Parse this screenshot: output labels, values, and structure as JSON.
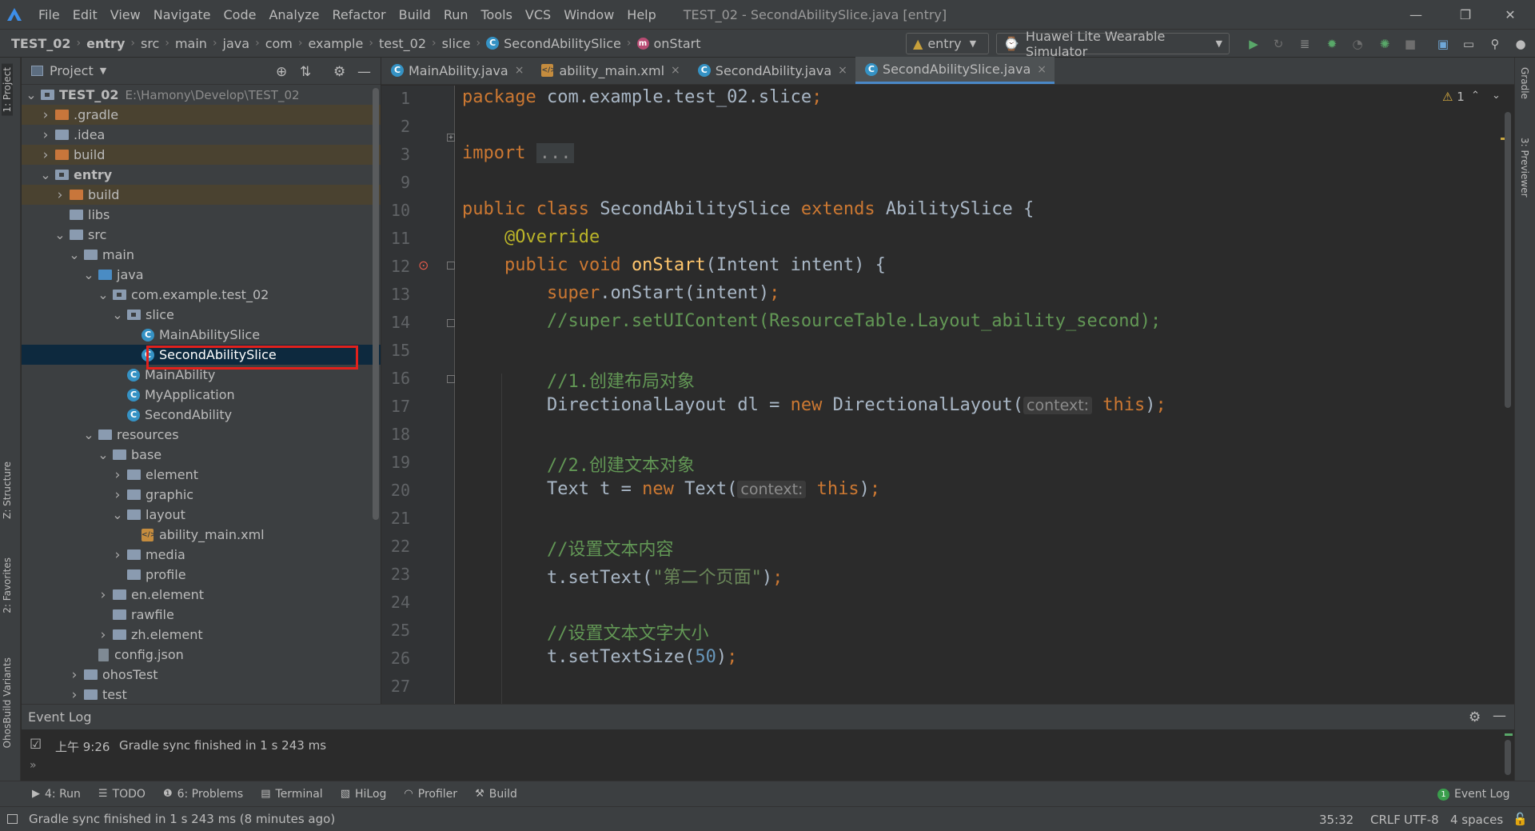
{
  "window": {
    "menu": [
      "File",
      "Edit",
      "View",
      "Navigate",
      "Code",
      "Analyze",
      "Refactor",
      "Build",
      "Run",
      "Tools",
      "VCS",
      "Window",
      "Help"
    ],
    "title": "TEST_02 - SecondAbilitySlice.java [entry]"
  },
  "navbar": {
    "crumbs": [
      "TEST_02",
      "entry",
      "src",
      "main",
      "java",
      "com",
      "example",
      "test_02",
      "slice",
      "SecondAbilitySlice",
      "onStart"
    ],
    "run_config": "entry",
    "device": "Huawei Lite Wearable Simulator"
  },
  "project_panel": {
    "title": "Project",
    "tree": [
      {
        "label": "TEST_02",
        "path": "E:\\Hamony\\Develop\\TEST_02",
        "indent": 0,
        "arrow": "open",
        "icon": "folder-module",
        "bold": true
      },
      {
        "label": ".gradle",
        "indent": 1,
        "arrow": "closed",
        "icon": "folder-orange",
        "hl": true
      },
      {
        "label": ".idea",
        "indent": 1,
        "arrow": "closed",
        "icon": "folder"
      },
      {
        "label": "build",
        "indent": 1,
        "arrow": "closed",
        "icon": "folder-orange",
        "hl": true
      },
      {
        "label": "entry",
        "indent": 1,
        "arrow": "open",
        "icon": "folder-module",
        "bold": true
      },
      {
        "label": "build",
        "indent": 2,
        "arrow": "closed",
        "icon": "folder-orange",
        "hl": true
      },
      {
        "label": "libs",
        "indent": 2,
        "arrow": "none",
        "icon": "folder"
      },
      {
        "label": "src",
        "indent": 2,
        "arrow": "open",
        "icon": "folder"
      },
      {
        "label": "main",
        "indent": 3,
        "arrow": "open",
        "icon": "folder"
      },
      {
        "label": "java",
        "indent": 4,
        "arrow": "open",
        "icon": "folder-blue"
      },
      {
        "label": "com.example.test_02",
        "indent": 5,
        "arrow": "open",
        "icon": "folder-pkg"
      },
      {
        "label": "slice",
        "indent": 6,
        "arrow": "open",
        "icon": "folder-pkg"
      },
      {
        "label": "MainAbilitySlice",
        "indent": 7,
        "arrow": "none",
        "icon": "class"
      },
      {
        "label": "SecondAbilitySlice",
        "indent": 7,
        "arrow": "none",
        "icon": "class",
        "sel": true
      },
      {
        "label": "MainAbility",
        "indent": 6,
        "arrow": "none",
        "icon": "class"
      },
      {
        "label": "MyApplication",
        "indent": 6,
        "arrow": "none",
        "icon": "class"
      },
      {
        "label": "SecondAbility",
        "indent": 6,
        "arrow": "none",
        "icon": "class"
      },
      {
        "label": "resources",
        "indent": 4,
        "arrow": "open",
        "icon": "folder"
      },
      {
        "label": "base",
        "indent": 5,
        "arrow": "open",
        "icon": "folder"
      },
      {
        "label": "element",
        "indent": 6,
        "arrow": "closed",
        "icon": "folder"
      },
      {
        "label": "graphic",
        "indent": 6,
        "arrow": "closed",
        "icon": "folder"
      },
      {
        "label": "layout",
        "indent": 6,
        "arrow": "open",
        "icon": "folder"
      },
      {
        "label": "ability_main.xml",
        "indent": 7,
        "arrow": "none",
        "icon": "xml"
      },
      {
        "label": "media",
        "indent": 6,
        "arrow": "closed",
        "icon": "folder"
      },
      {
        "label": "profile",
        "indent": 6,
        "arrow": "none",
        "icon": "folder"
      },
      {
        "label": "en.element",
        "indent": 5,
        "arrow": "closed",
        "icon": "folder"
      },
      {
        "label": "rawfile",
        "indent": 5,
        "arrow": "none",
        "icon": "folder"
      },
      {
        "label": "zh.element",
        "indent": 5,
        "arrow": "closed",
        "icon": "folder"
      },
      {
        "label": "config.json",
        "indent": 4,
        "arrow": "none",
        "icon": "json"
      },
      {
        "label": "ohosTest",
        "indent": 3,
        "arrow": "closed",
        "icon": "folder"
      },
      {
        "label": "test",
        "indent": 3,
        "arrow": "closed",
        "icon": "folder"
      }
    ]
  },
  "tabs": [
    {
      "label": "MainAbility.java",
      "icon": "class"
    },
    {
      "label": "ability_main.xml",
      "icon": "xml"
    },
    {
      "label": "SecondAbility.java",
      "icon": "class"
    },
    {
      "label": "SecondAbilitySlice.java",
      "icon": "class",
      "active": true
    }
  ],
  "editor": {
    "warning_count": "1",
    "lines": [
      {
        "n": "1",
        "html": "<span class='kw'>package</span> com.example.test_02.slice<span class='kw'>;</span>"
      },
      {
        "n": "2",
        "html": ""
      },
      {
        "n": "3",
        "html": "<span class='kw'>import</span> <span class='fold-box'>...</span>"
      },
      {
        "n": "9",
        "html": ""
      },
      {
        "n": "10",
        "html": "<span class='kw'>public class</span> SecondAbilitySlice <span class='kw'>extends</span> AbilitySlice {"
      },
      {
        "n": "11",
        "html": "    <span class='ann'>@Override</span>"
      },
      {
        "n": "12",
        "html": "    <span class='kw'>public void</span> <span class='fn'>onStart</span>(Intent intent) {"
      },
      {
        "n": "13",
        "html": "        <span class='kw'>super</span>.onStart(intent)<span class='kw'>;</span>"
      },
      {
        "n": "14",
        "html": "        <span class='cm'>//super.setUIContent(ResourceTable.Layout_ability_second);</span>"
      },
      {
        "n": "15",
        "html": ""
      },
      {
        "n": "16",
        "html": "        <span class='cm'>//1.创建布局对象</span>"
      },
      {
        "n": "17",
        "html": "        DirectionalLayout dl = <span class='kw'>new</span> DirectionalLayout(<span class='hint'>context:</span> <span class='kw'>this</span>)<span class='kw'>;</span>"
      },
      {
        "n": "18",
        "html": ""
      },
      {
        "n": "19",
        "html": "        <span class='cm'>//2.创建文本对象</span>"
      },
      {
        "n": "20",
        "html": "        Text t = <span class='kw'>new</span> Text(<span class='hint'>context:</span> <span class='kw'>this</span>)<span class='kw'>;</span>"
      },
      {
        "n": "21",
        "html": ""
      },
      {
        "n": "22",
        "html": "        <span class='cm'>//设置文本内容</span>"
      },
      {
        "n": "23",
        "html": "        t.setText(<span class='str'>\"第二个页面\"</span>)<span class='kw'>;</span>"
      },
      {
        "n": "24",
        "html": ""
      },
      {
        "n": "25",
        "html": "        <span class='cm'>//设置文本文字大小</span>"
      },
      {
        "n": "26",
        "html": "        t.setTextSize(<span class='num'>50</span>)<span class='kw'>;</span>"
      },
      {
        "n": "27",
        "html": ""
      }
    ]
  },
  "event_log": {
    "title": "Event Log",
    "time": "上午 9:26",
    "message": "Gradle sync finished in 1 s 243 ms"
  },
  "bottom_tools": [
    "4: Run",
    "TODO",
    "6: Problems",
    "Terminal",
    "HiLog",
    "Profiler",
    "Build"
  ],
  "event_log_button": "Event Log",
  "event_log_badge": "1",
  "status": {
    "message": "Gradle sync finished in 1 s 243 ms (8 minutes ago)",
    "position": "35:32",
    "line_sep": "CRLF",
    "encoding": "UTF-8",
    "indent": "4 spaces"
  },
  "left_stripe": [
    "1: Project",
    "Z: Structure",
    "2: Favorites",
    "OhosBuild Variants"
  ],
  "right_stripe": [
    "Gradle",
    "3: Previewer"
  ]
}
